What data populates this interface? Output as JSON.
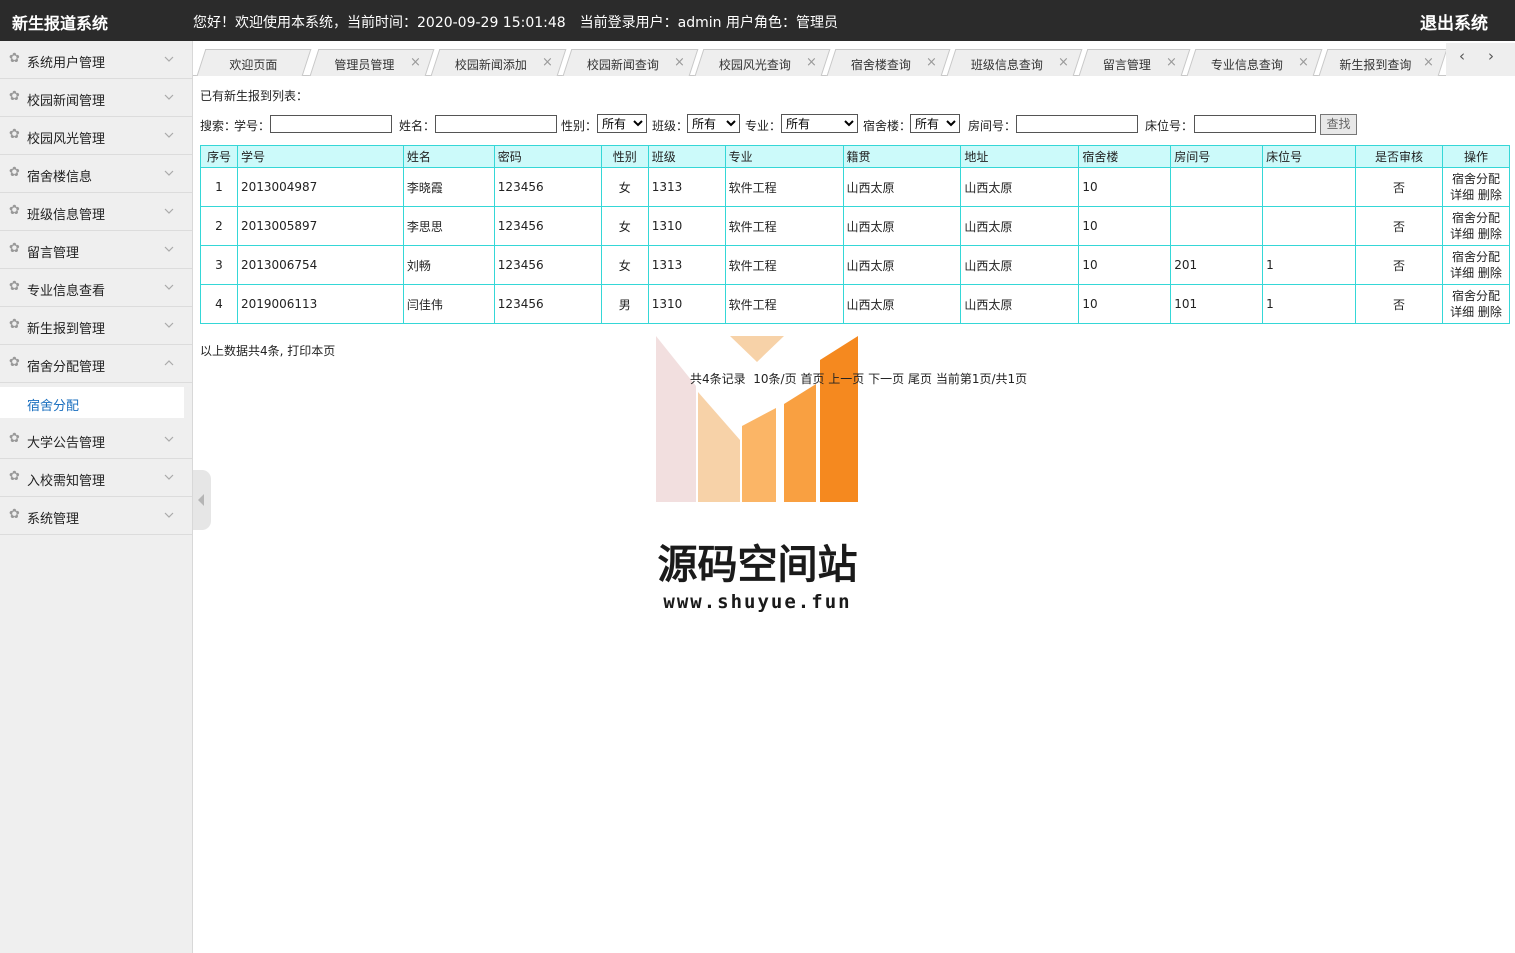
{
  "header": {
    "app_title": "新生报道系统",
    "greeting": "您好！欢迎使用本系统，当前时间：2020-09-29 15:01:48　当前登录用户：admin  用户角色：管理员",
    "logout": "退出系统"
  },
  "sidebar": {
    "items": [
      {
        "label": "系统用户管理",
        "expanded": false
      },
      {
        "label": "校园新闻管理",
        "expanded": false
      },
      {
        "label": "校园风光管理",
        "expanded": false
      },
      {
        "label": "宿舍楼信息",
        "expanded": false
      },
      {
        "label": "班级信息管理",
        "expanded": false
      },
      {
        "label": "留言管理",
        "expanded": false
      },
      {
        "label": "专业信息查看",
        "expanded": false
      },
      {
        "label": "新生报到管理",
        "expanded": false
      },
      {
        "label": "宿舍分配管理",
        "expanded": true
      },
      {
        "label": "大学公告管理",
        "expanded": false
      },
      {
        "label": "入校需知管理",
        "expanded": false
      },
      {
        "label": "系统管理",
        "expanded": false
      }
    ],
    "subitem": "宿舍分配"
  },
  "tabs": [
    {
      "label": "欢迎页面",
      "closable": false
    },
    {
      "label": "管理员管理",
      "closable": true
    },
    {
      "label": "校园新闻添加",
      "closable": true
    },
    {
      "label": "校园新闻查询",
      "closable": true
    },
    {
      "label": "校园风光查询",
      "closable": true
    },
    {
      "label": "宿舍楼查询",
      "closable": true
    },
    {
      "label": "班级信息查询",
      "closable": true
    },
    {
      "label": "留言管理",
      "closable": true
    },
    {
      "label": "专业信息查询",
      "closable": true
    },
    {
      "label": "新生报到查询",
      "closable": true
    }
  ],
  "tab_nav": {
    "prev": "‹",
    "next": "›"
  },
  "page": {
    "list_title": "已有新生报到列表：",
    "search": {
      "prefix": "搜索：",
      "student_no_label": "学号：",
      "name_label": "姓名：",
      "gender_label": "性别：",
      "gender_value": "所有",
      "class_label": "班级：",
      "class_value": "所有",
      "major_label": "专业：",
      "major_value": "所有",
      "building_label": "宿舍楼：",
      "building_value": "所有",
      "room_label": "房间号：",
      "bed_label": "床位号：",
      "button": "查找"
    },
    "columns": [
      "序号",
      "学号",
      "姓名",
      "密码",
      "性别",
      "班级",
      "专业",
      "籍贯",
      "地址",
      "宿舍楼",
      "房间号",
      "床位号",
      "是否审核",
      "操作"
    ],
    "rows": [
      {
        "no": "1",
        "student_no": "2013004987",
        "name": "李晓霞",
        "password": "123456",
        "gender": "女",
        "class": "1313",
        "major": "软件工程",
        "native": "山西太原",
        "address": "山西太原",
        "building": "10",
        "room": "",
        "bed": "",
        "approved": "否"
      },
      {
        "no": "2",
        "student_no": "2013005897",
        "name": "李思思",
        "password": "123456",
        "gender": "女",
        "class": "1310",
        "major": "软件工程",
        "native": "山西太原",
        "address": "山西太原",
        "building": "10",
        "room": "",
        "bed": "",
        "approved": "否"
      },
      {
        "no": "3",
        "student_no": "2013006754",
        "name": "刘畅",
        "password": "123456",
        "gender": "女",
        "class": "1313",
        "major": "软件工程",
        "native": "山西太原",
        "address": "山西太原",
        "building": "10",
        "room": "201",
        "bed": "1",
        "approved": "否"
      },
      {
        "no": "4",
        "student_no": "2019006113",
        "name": "闫佳伟",
        "password": "123456",
        "gender": "男",
        "class": "1310",
        "major": "软件工程",
        "native": "山西太原",
        "address": "山西太原",
        "building": "10",
        "room": "101",
        "bed": "1",
        "approved": "否"
      }
    ],
    "ops": {
      "assign": "宿舍分配",
      "detail": "详细",
      "delete": "删除"
    },
    "summary_text": "以上数据共4条,",
    "print_link": "打印本页",
    "pager": {
      "total": "共4条记录",
      "per_page": "10条/页",
      "first": "首页",
      "prev": "上一页",
      "next": "下一页",
      "last": "尾页",
      "current": "当前第1页/共1页"
    }
  },
  "watermark": {
    "title": "源码空间站",
    "url": "www.shuyue.fun",
    "colors": {
      "orange": "#f5891f",
      "light_orange": "#fbb566",
      "peach": "#f7d2a8",
      "pink": "#f2dfdf"
    }
  }
}
